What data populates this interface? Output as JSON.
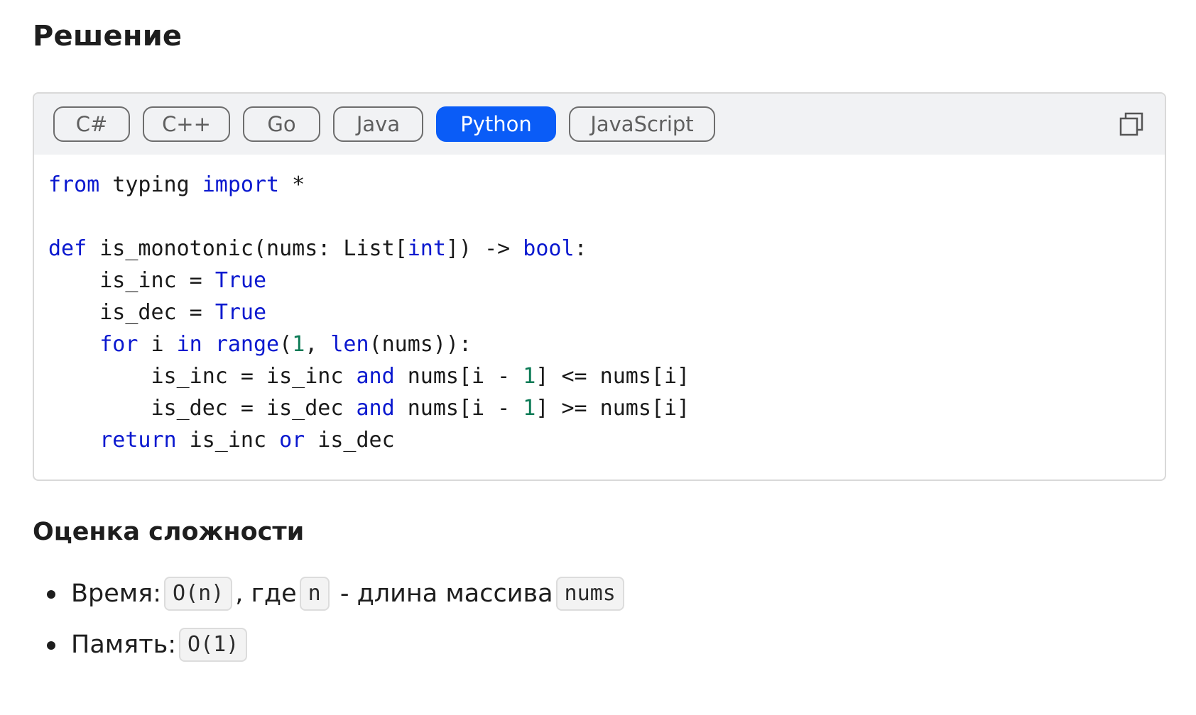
{
  "solution_title": "Решение",
  "code_block": {
    "tabs": [
      {
        "label": "C#",
        "active": false
      },
      {
        "label": "C++",
        "active": false
      },
      {
        "label": "Go",
        "active": false
      },
      {
        "label": "Java",
        "active": false
      },
      {
        "label": "Python",
        "active": true
      },
      {
        "label": "JavaScript",
        "active": false
      }
    ],
    "copy_icon": "copy-icon",
    "accent_color": "#0a5cf7",
    "keyword_color": "#0a18cf",
    "number_color": "#0b7a55",
    "lines": [
      [
        {
          "t": "from",
          "k": "kw"
        },
        {
          "t": " typing "
        },
        {
          "t": "import",
          "k": "kw"
        },
        {
          "t": " *"
        }
      ],
      [],
      [
        {
          "t": "def",
          "k": "kw"
        },
        {
          "t": " is_monotonic(nums: List["
        },
        {
          "t": "int",
          "k": "kw"
        },
        {
          "t": "]) -> "
        },
        {
          "t": "bool",
          "k": "kw"
        },
        {
          "t": ":"
        }
      ],
      [
        {
          "t": "    is_inc = "
        },
        {
          "t": "True",
          "k": "kw"
        }
      ],
      [
        {
          "t": "    is_dec = "
        },
        {
          "t": "True",
          "k": "kw"
        }
      ],
      [
        {
          "t": "    "
        },
        {
          "t": "for",
          "k": "kw"
        },
        {
          "t": " i "
        },
        {
          "t": "in",
          "k": "kw"
        },
        {
          "t": " "
        },
        {
          "t": "range",
          "k": "kw"
        },
        {
          "t": "("
        },
        {
          "t": "1",
          "k": "num"
        },
        {
          "t": ", "
        },
        {
          "t": "len",
          "k": "kw"
        },
        {
          "t": "(nums)):"
        }
      ],
      [
        {
          "t": "        is_inc = is_inc "
        },
        {
          "t": "and",
          "k": "kw"
        },
        {
          "t": " nums[i - "
        },
        {
          "t": "1",
          "k": "num"
        },
        {
          "t": "] <= nums[i]"
        }
      ],
      [
        {
          "t": "        is_dec = is_dec "
        },
        {
          "t": "and",
          "k": "kw"
        },
        {
          "t": " nums[i - "
        },
        {
          "t": "1",
          "k": "num"
        },
        {
          "t": "] >= nums[i]"
        }
      ],
      [
        {
          "t": "    "
        },
        {
          "t": "return",
          "k": "kw"
        },
        {
          "t": " is_inc "
        },
        {
          "t": "or",
          "k": "kw"
        },
        {
          "t": " is_dec"
        }
      ]
    ]
  },
  "complexity_title": "Оценка сложности",
  "complexity": {
    "time_label": "Время:",
    "time_value": "O(n)",
    "time_where": ", где",
    "time_var": "n",
    "time_desc": " - длина массива",
    "time_array": "nums",
    "memory_label": "Память:",
    "memory_value": "O(1)"
  }
}
